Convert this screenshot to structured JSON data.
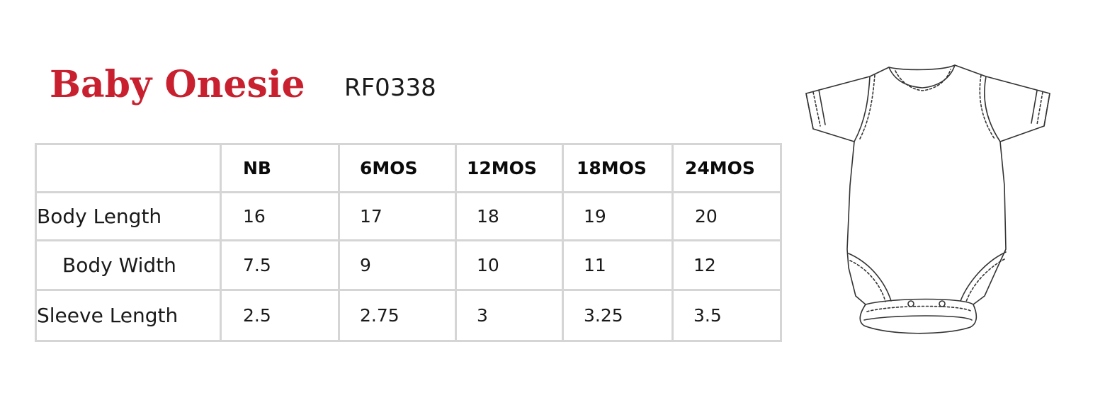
{
  "header": {
    "title": "Baby Onesie",
    "code": "RF0338"
  },
  "table": {
    "columns": [
      "",
      "NB",
      "6MOS",
      "12MOS",
      "18MOS",
      "24MOS"
    ],
    "rows": [
      {
        "label": "Body Length",
        "values": [
          "16",
          "17",
          "18",
          "19",
          "20"
        ]
      },
      {
        "label": "Body Width",
        "values": [
          "7.5",
          "9",
          "10",
          "11",
          "12"
        ]
      },
      {
        "label": "Sleeve Length",
        "values": [
          "2.5",
          "2.75",
          "3",
          "3.25",
          "3.5"
        ]
      }
    ]
  },
  "colors": {
    "title": "#c8202e",
    "grid": "#d5d5d5",
    "text": "#1a1a1a"
  },
  "illustration": {
    "icon": "baby-onesie-icon"
  }
}
